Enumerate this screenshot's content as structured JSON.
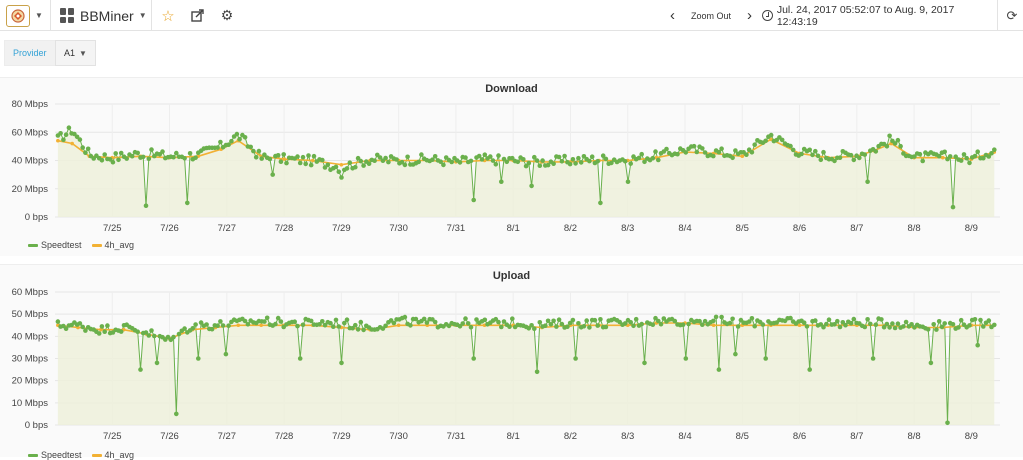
{
  "toolbar": {
    "dashboard_title": "BBMiner",
    "zoom_label": "Zoom Out",
    "time_range": "Jul. 24, 2017 05:52:07 to Aug. 9, 2017 12:43:19"
  },
  "icons": {
    "logo": "app-logo-icon",
    "dashboards": "grid-icon",
    "favorite": "star-icon",
    "share": "share-icon",
    "settings": "gear-icon",
    "back": "chevron-left-icon",
    "forward": "chevron-right-icon",
    "time": "clock-icon",
    "refresh": "refresh-icon"
  },
  "variables": {
    "label": "Provider",
    "value": "A1"
  },
  "colors": {
    "speedtest": "#6ab04c",
    "avg": "#f2b134",
    "fill": "#edf0da"
  },
  "chart_data": [
    {
      "type": "line",
      "title": "Download",
      "ylim": [
        0,
        80
      ],
      "yticks": [
        "0 bps",
        "20 Mbps",
        "40 Mbps",
        "60 Mbps",
        "80 Mbps"
      ],
      "xticks": [
        "7/25",
        "7/26",
        "7/27",
        "7/28",
        "7/29",
        "7/30",
        "7/31",
        "8/1",
        "8/2",
        "8/3",
        "8/4",
        "8/5",
        "8/6",
        "8/7",
        "8/8",
        "8/9"
      ],
      "x_range": [
        24.0,
        40.5
      ],
      "x": [
        24.05,
        24.3,
        24.6,
        25.0,
        25.5,
        26.0,
        26.5,
        26.9,
        27.2,
        27.6,
        28.0,
        28.5,
        29.0,
        29.5,
        30.0,
        30.5,
        31.0,
        31.5,
        32.0,
        32.5,
        33.0,
        33.5,
        34.0,
        34.5,
        35.0,
        35.5,
        36.0,
        36.5,
        37.0,
        37.5,
        38.0,
        38.3,
        38.6,
        39.0,
        39.5,
        40.0,
        40.4
      ],
      "series": [
        {
          "name": "Speedtest",
          "style": "points",
          "values": [
            55,
            62,
            44,
            42,
            45,
            43,
            44,
            50,
            58,
            42,
            41,
            40,
            35,
            41,
            40,
            41,
            39,
            41,
            40,
            39,
            40,
            41,
            41,
            43,
            48,
            46,
            44,
            58,
            46,
            43,
            44,
            48,
            55,
            42,
            43,
            41,
            48
          ],
          "dips": [
            {
              "x": 25.6,
              "y": 8
            },
            {
              "x": 26.3,
              "y": 10
            },
            {
              "x": 27.8,
              "y": 30
            },
            {
              "x": 29.0,
              "y": 28
            },
            {
              "x": 31.3,
              "y": 12
            },
            {
              "x": 31.8,
              "y": 25
            },
            {
              "x": 32.3,
              "y": 22
            },
            {
              "x": 33.5,
              "y": 10
            },
            {
              "x": 34.0,
              "y": 25
            },
            {
              "x": 38.2,
              "y": 25
            },
            {
              "x": 39.7,
              "y": 7
            }
          ]
        },
        {
          "name": "4h_avg",
          "style": "line",
          "values": [
            54,
            52,
            43,
            42,
            43,
            42,
            43,
            48,
            54,
            43,
            41,
            40,
            37,
            40,
            40,
            40,
            39,
            40,
            40,
            39,
            39,
            40,
            40,
            42,
            46,
            45,
            43,
            55,
            45,
            42,
            43,
            47,
            52,
            42,
            42,
            41,
            46
          ]
        }
      ]
    },
    {
      "type": "line",
      "title": "Upload",
      "ylim": [
        0,
        60
      ],
      "yticks": [
        "0 bps",
        "10 Mbps",
        "20 Mbps",
        "30 Mbps",
        "40 Mbps",
        "50 Mbps",
        "60 Mbps"
      ],
      "xticks": [
        "7/25",
        "7/26",
        "7/27",
        "7/28",
        "7/29",
        "7/30",
        "7/31",
        "8/1",
        "8/2",
        "8/3",
        "8/4",
        "8/5",
        "8/6",
        "8/7",
        "8/8",
        "8/9"
      ],
      "x_range": [
        24.0,
        40.5
      ],
      "x": [
        24.05,
        24.4,
        24.8,
        25.2,
        25.6,
        26.0,
        26.4,
        26.8,
        27.2,
        27.6,
        28.0,
        28.5,
        29.0,
        29.5,
        30.0,
        30.5,
        31.0,
        31.5,
        32.0,
        32.5,
        33.0,
        33.5,
        34.0,
        34.5,
        35.0,
        35.5,
        36.0,
        36.5,
        37.0,
        37.5,
        38.0,
        38.5,
        39.0,
        39.5,
        40.0,
        40.4
      ],
      "series": [
        {
          "name": "Speedtest",
          "style": "points",
          "values": [
            45,
            45,
            43,
            44,
            42,
            38,
            45,
            45,
            46,
            47,
            46,
            46,
            46,
            44,
            47,
            46,
            46,
            46,
            46,
            45,
            46,
            46,
            46,
            47,
            47,
            47,
            46,
            47,
            46,
            46,
            46,
            46,
            45,
            45,
            46,
            46
          ],
          "dips": [
            {
              "x": 25.5,
              "y": 25
            },
            {
              "x": 25.8,
              "y": 28
            },
            {
              "x": 26.1,
              "y": 5
            },
            {
              "x": 26.5,
              "y": 30
            },
            {
              "x": 27.0,
              "y": 32
            },
            {
              "x": 28.3,
              "y": 30
            },
            {
              "x": 29.0,
              "y": 28
            },
            {
              "x": 31.3,
              "y": 30
            },
            {
              "x": 32.4,
              "y": 24
            },
            {
              "x": 33.1,
              "y": 30
            },
            {
              "x": 34.3,
              "y": 28
            },
            {
              "x": 35.0,
              "y": 30
            },
            {
              "x": 35.6,
              "y": 25
            },
            {
              "x": 35.9,
              "y": 32
            },
            {
              "x": 36.4,
              "y": 30
            },
            {
              "x": 37.2,
              "y": 25
            },
            {
              "x": 38.3,
              "y": 30
            },
            {
              "x": 39.3,
              "y": 28
            },
            {
              "x": 39.6,
              "y": 1
            },
            {
              "x": 40.1,
              "y": 36
            }
          ]
        },
        {
          "name": "4h_avg",
          "style": "line",
          "values": [
            45,
            44,
            43,
            43,
            41,
            39,
            43,
            44,
            45,
            45,
            45,
            45,
            44,
            43,
            45,
            45,
            45,
            45,
            45,
            44,
            45,
            45,
            45,
            46,
            46,
            45,
            45,
            45,
            45,
            45,
            45,
            45,
            44,
            44,
            45,
            45
          ]
        }
      ]
    }
  ]
}
